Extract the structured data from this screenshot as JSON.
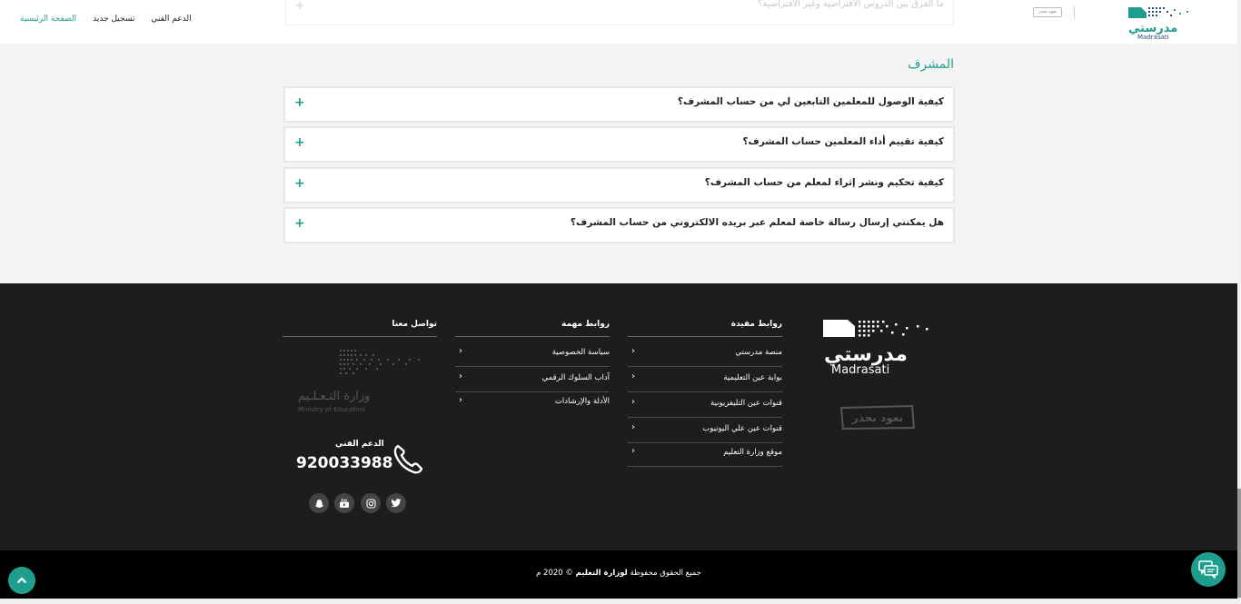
{
  "header": {
    "nav": {
      "home": "الصفحة الرئيسية",
      "register": "تسجيل جديد",
      "support": "الدعم الفني"
    },
    "ghost_question": "ما الفرق بين الدروس الافتراضية وغير الافتراضية؟",
    "nahood_small": "نعود بحذر",
    "logo_text": "مدرستي",
    "logo_latin": "Madrasati"
  },
  "faq": {
    "section_title": "المشرف",
    "items": [
      {
        "question": "كيفية الوصول للمعلمين التابعين لي من حساب المشرف؟",
        "toggle": "+"
      },
      {
        "question": "كيفية تقييم أداء المعلمين حساب المشرف؟",
        "toggle": "+"
      },
      {
        "question": "كيفية تحكيم ونشر إثراء لمعلم من حساب المشرف؟",
        "toggle": "+"
      },
      {
        "question": "هل يمكنني إرسال رسالة خاصة لمعلم عبر بريده الالكتروني من حساب المشرف؟",
        "toggle": "+"
      }
    ]
  },
  "footer": {
    "useful_links": {
      "title": "روابط مفيدة",
      "items": [
        "منصة مدرستي",
        "بوابة عين التعليمية",
        "قنوات عين التليفزيونية",
        "قنوات عين علي اليوتيوب",
        "موقع وزارة التعليم"
      ]
    },
    "important_links": {
      "title": "روابط مهمة",
      "items": [
        "سياسة الخصوصية",
        "آداب السلوك الرقمي",
        "الأدلة والإرشادات"
      ]
    },
    "contact": {
      "title": "تواصل معنا",
      "ministry_ar": "وزارة التـعـلـيم",
      "ministry_en": "Ministry of Education",
      "support_label": "الدعم الفني",
      "support_number": "920033988"
    },
    "logo_text": "مدرستي",
    "logo_latin": "Madrasati",
    "nahood_big": "نعود بحذر",
    "chevron": "›",
    "copyright_prefix": "جميع الحقوق محفوظة",
    "copyright_owner": "لوزارة التعليم",
    "copyright_suffix": "© 2020 م"
  },
  "icons": [
    "twitter-icon",
    "instagram-icon",
    "youtube-icon",
    "snapchat-icon",
    "phone-icon",
    "chevron-up-icon",
    "chat-icon"
  ],
  "colors": {
    "accent": "#1f9e8e",
    "footer_bg": "#1d1d1d",
    "bottom_bar": "#000000",
    "page_bg": "#f3f3f3"
  }
}
